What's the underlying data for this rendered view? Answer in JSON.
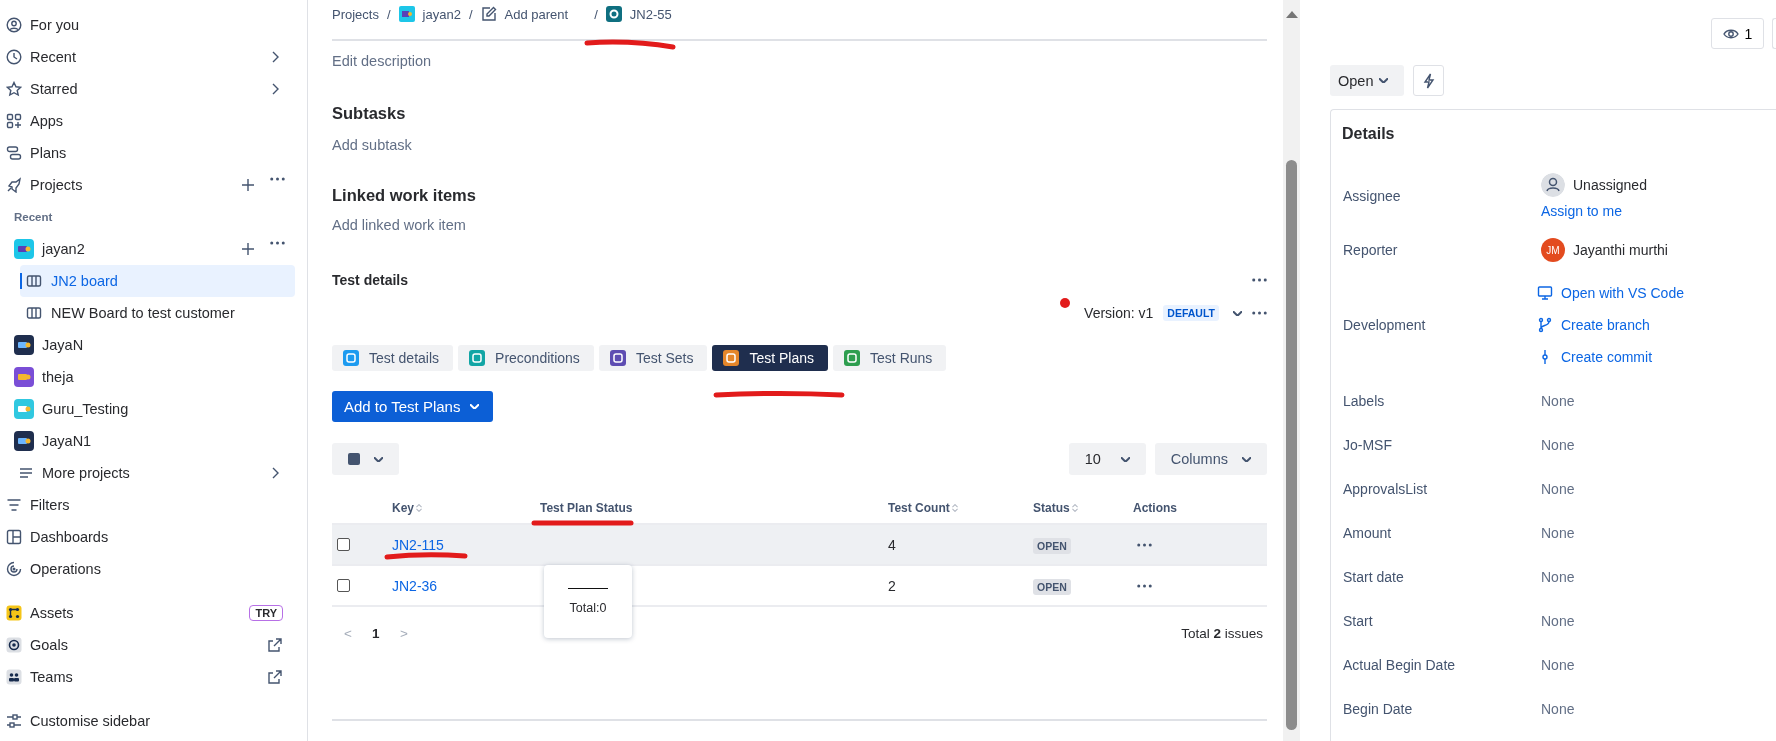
{
  "sidebar": {
    "sections": [
      {
        "items": [
          {
            "kind": "nav",
            "label": "For you"
          },
          {
            "kind": "nav",
            "label": "Recent",
            "submenu": true
          },
          {
            "kind": "nav",
            "label": "Starred",
            "submenu": true
          },
          {
            "kind": "nav",
            "label": "Apps"
          },
          {
            "kind": "nav",
            "label": "Plans"
          },
          {
            "kind": "nav",
            "label": "Projects",
            "actions": true
          },
          {
            "kind": "heading",
            "label": "Recent"
          },
          {
            "kind": "project",
            "label": "jayan2",
            "actions": true,
            "children": [
              {
                "label": "JN2 board",
                "selected": true
              },
              {
                "label": "NEW Board to test customer",
                "selected": false
              }
            ]
          },
          {
            "kind": "project",
            "label": "JayaN"
          },
          {
            "kind": "project",
            "label": "theja"
          },
          {
            "kind": "project",
            "label": "Guru_Testing"
          },
          {
            "kind": "project",
            "label": "JayaN1"
          },
          {
            "kind": "more",
            "label": "More projects",
            "submenu": true
          },
          {
            "kind": "nav",
            "label": "Filters"
          },
          {
            "kind": "nav",
            "label": "Dashboards"
          },
          {
            "kind": "nav",
            "label": "Operations"
          }
        ]
      },
      {
        "items": [
          {
            "kind": "nav",
            "label": "Assets",
            "badge": "TRY"
          },
          {
            "kind": "nav",
            "label": "Goals",
            "external": true
          },
          {
            "kind": "nav",
            "label": "Teams",
            "external": true
          }
        ]
      },
      {
        "items": [
          {
            "kind": "nav",
            "label": "Customise sidebar"
          }
        ]
      }
    ]
  },
  "breadcrumb": [
    {
      "label": "Projects",
      "separator": "/"
    },
    {
      "label": "jayan2",
      "separator": "/"
    },
    {
      "label": "Add parent",
      "separator": "/"
    },
    {
      "label": "JN2-55"
    }
  ],
  "description": {
    "placeholder": "Edit description"
  },
  "subtasks": {
    "heading": "Subtasks",
    "placeholder": "Add subtask"
  },
  "linked_items": {
    "heading": "Linked work items",
    "placeholder": "Add linked work item"
  },
  "test_details": {
    "title": "Test details",
    "version": "Version: v1",
    "version_badge": "DEFAULT",
    "tabs": [
      {
        "label": "Test details",
        "selected": false
      },
      {
        "label": "Preconditions",
        "selected": false
      },
      {
        "label": "Test Sets",
        "selected": false
      },
      {
        "label": "Test Plans",
        "selected": true
      },
      {
        "label": "Test Runs",
        "selected": false
      }
    ],
    "add_button": "Add to Test Plans",
    "page_size": "10",
    "columns_button": "Columns",
    "table": {
      "columns": [
        {
          "label": "Key",
          "sortable": true
        },
        {
          "label": "Test Plan Status",
          "sortable": false
        },
        {
          "label": "Test Count",
          "sortable": true
        },
        {
          "label": "Status",
          "sortable": true
        },
        {
          "label": "Actions",
          "sortable": false
        }
      ],
      "rows": [
        {
          "checked": false,
          "hovered": true,
          "key": "JN2-115",
          "test_count": "4",
          "status": "OPEN"
        },
        {
          "checked": false,
          "hovered": false,
          "key": "JN2-36",
          "test_count": "2",
          "status": "OPEN"
        }
      ]
    },
    "tooltip": {
      "text": "Total:0"
    },
    "pagination": {
      "prev": "<",
      "next": ">",
      "pages": [
        {
          "label": "1",
          "selected": true
        }
      ],
      "total": "Total **2** issues"
    }
  },
  "watchers": "1",
  "status_button": "Open",
  "details": {
    "title": "Details",
    "fields": [
      {
        "kind": "person",
        "label": "Assignee",
        "value": "Unassigned",
        "link": "Assign to me"
      },
      {
        "kind": "person",
        "label": "Reporter",
        "value": "Jayanthi murthi",
        "avatar": "JM"
      },
      {
        "kind": "links",
        "label": "Development",
        "links": [
          "Open with VS Code",
          "Create branch",
          "Create commit"
        ]
      },
      {
        "kind": "text",
        "label": "Labels",
        "value": "None"
      },
      {
        "kind": "text",
        "label": "Jo-MSF",
        "value": "None"
      },
      {
        "kind": "text",
        "label": "ApprovalsList",
        "value": "None"
      },
      {
        "kind": "text",
        "label": "Amount",
        "value": "None"
      },
      {
        "kind": "text",
        "label": "Start date",
        "value": "None"
      },
      {
        "kind": "text",
        "label": "Start",
        "value": "None"
      },
      {
        "kind": "text",
        "label": "Actual Begin Date",
        "value": "None"
      },
      {
        "kind": "text",
        "label": "Begin Date",
        "value": "None"
      }
    ]
  }
}
